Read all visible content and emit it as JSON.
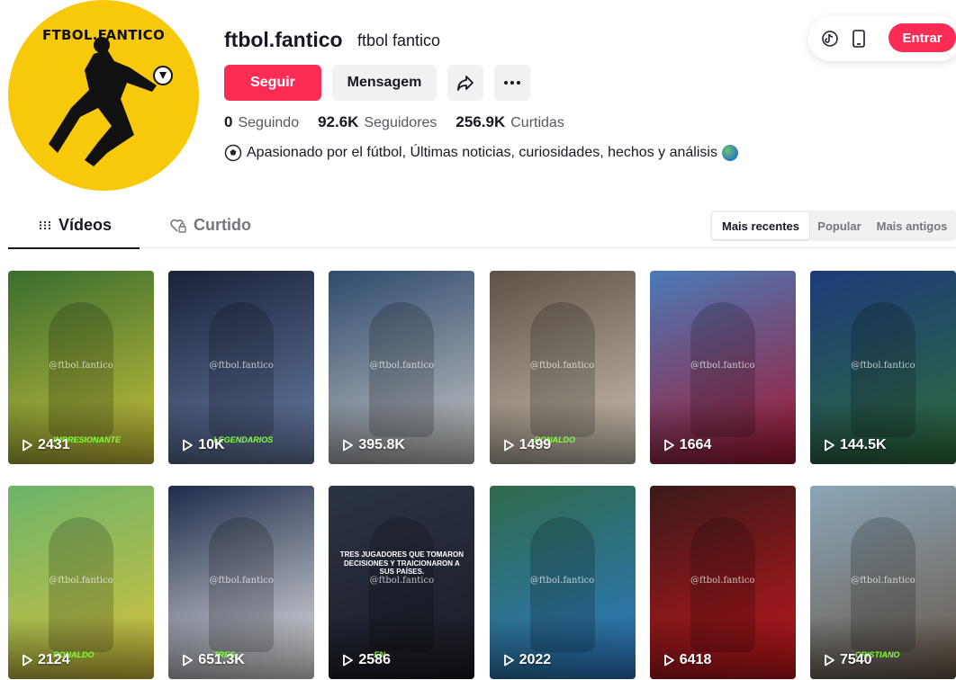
{
  "profile": {
    "avatar_text": "FTBOL.FANTICO",
    "username": "ftbol.fantico",
    "nickname": "ftbol fantico",
    "follow_label": "Seguir",
    "message_label": "Mensagem",
    "stats": [
      {
        "value": "0",
        "label": "Seguindo"
      },
      {
        "value": "92.6K",
        "label": "Seguidores"
      },
      {
        "value": "256.9K",
        "label": "Curtidas"
      }
    ],
    "bio": "Apasionado por el fútbol, Últimas noticias, curiosidades, hechos y análisis"
  },
  "topbar": {
    "login_label": "Entrar"
  },
  "tabs": [
    {
      "label": "Vídeos",
      "icon": "grid-icon"
    },
    {
      "label": "Curtido",
      "icon": "heart-lock-icon"
    }
  ],
  "sort": [
    "Mais recentes",
    "Popular",
    "Mais antigos"
  ],
  "videos": [
    {
      "views": "2431",
      "caption": "IMPRESIONANTE",
      "watermark": "@ftbol.fantico",
      "colors": [
        "#3a6d2f",
        "#c9c23a"
      ]
    },
    {
      "views": "10K",
      "caption": "LEGENDARIOS",
      "watermark": "@ftbol.fantico",
      "colors": [
        "#1a2238",
        "#6a7fa8"
      ]
    },
    {
      "views": "395.8K",
      "caption": "",
      "watermark": "@ftbol.fantico",
      "colors": [
        "#2e4a6e",
        "#c9c8c4"
      ]
    },
    {
      "views": "1499",
      "caption": "RONALDO",
      "watermark": "@ftbol.fantico",
      "colors": [
        "#5c5146",
        "#cfc5b5"
      ]
    },
    {
      "views": "1664",
      "caption": "",
      "watermark": "@ftbol.fantico",
      "colors": [
        "#4a7ab8",
        "#a4162e"
      ]
    },
    {
      "views": "144.5K",
      "caption": "",
      "watermark": "@ftbol.fantico",
      "colors": [
        "#1d3a7a",
        "#2e6e3a"
      ]
    },
    {
      "views": "2124",
      "caption": "RONALDO",
      "watermark": "@ftbol.fantico",
      "colors": [
        "#6bb46a",
        "#d8c23a"
      ]
    },
    {
      "views": "651.3K",
      "caption": "TRES",
      "watermark": "@ftbol.fantico",
      "colors": [
        "#1e2b4a",
        "#e8e8e8"
      ]
    },
    {
      "views": "2586",
      "caption": "EN",
      "watermark": "@ftbol.fantico",
      "colors": [
        "#2b3446",
        "#1a1a22"
      ],
      "title_text": "TRES JUGADORES QUE TOMARON DECISIONES Y TRAICIONARON A SUS PAÍSES."
    },
    {
      "views": "2022",
      "caption": "",
      "watermark": "@ftbol.fantico",
      "colors": [
        "#2f6a4a",
        "#2c7ac9"
      ]
    },
    {
      "views": "6418",
      "caption": "",
      "watermark": "@ftbol.fantico",
      "colors": [
        "#3a1a1a",
        "#c4161c"
      ]
    },
    {
      "views": "7540",
      "caption": "CRISTIANO",
      "watermark": "@ftbol.fantico",
      "colors": [
        "#8aa6b8",
        "#6a5848"
      ]
    }
  ]
}
